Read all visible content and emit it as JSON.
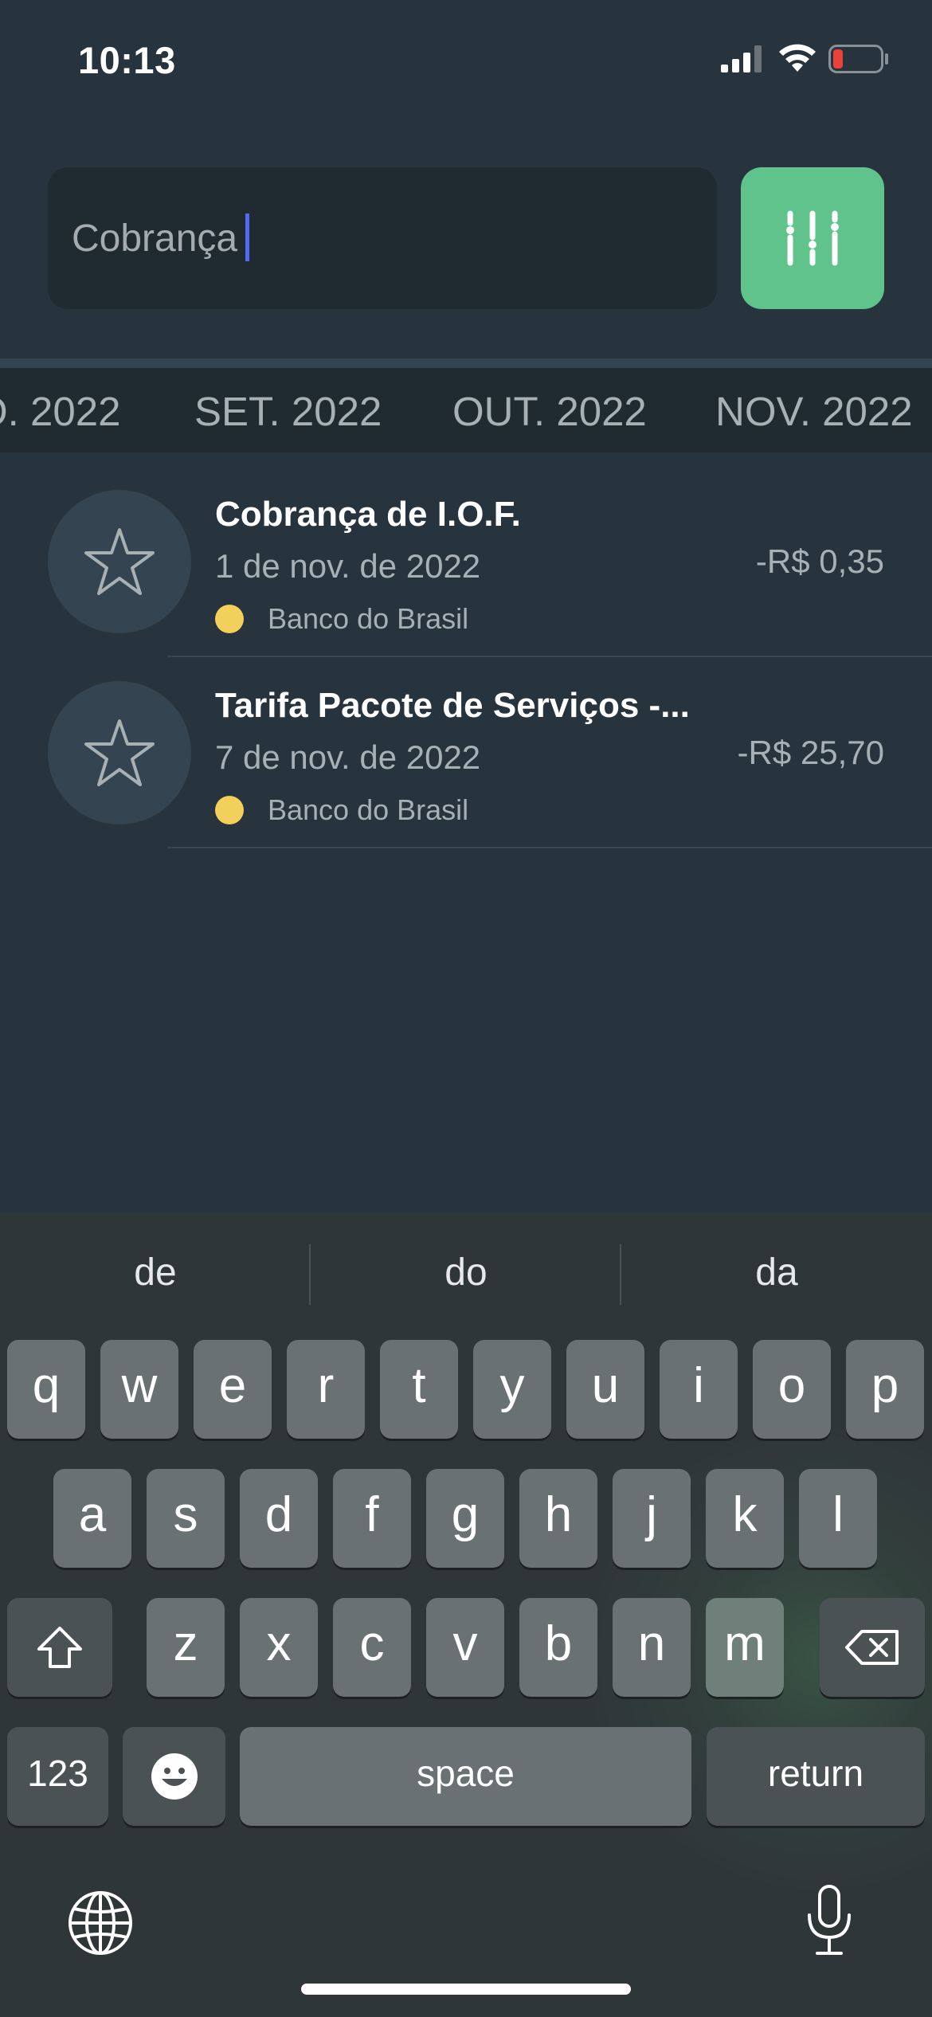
{
  "status_bar": {
    "time": "10:13"
  },
  "search": {
    "value": "Cobrança"
  },
  "months": [
    "O. 2022",
    "SET. 2022",
    "OUT. 2022",
    "NOV. 2022"
  ],
  "transactions": [
    {
      "title": "Cobrança de I.O.F.",
      "date": "1 de nov. de 2022",
      "bank": "Banco do Brasil",
      "amount": "-R$ 0,35"
    },
    {
      "title": "Tarifa Pacote de Serviços -...",
      "date": "7 de nov. de 2022",
      "bank": "Banco do Brasil",
      "amount": "-R$ 25,70"
    }
  ],
  "keyboard": {
    "suggestions": [
      "de",
      "do",
      "da"
    ],
    "row1": [
      "q",
      "w",
      "e",
      "r",
      "t",
      "y",
      "u",
      "i",
      "o",
      "p"
    ],
    "row2": [
      "a",
      "s",
      "d",
      "f",
      "g",
      "h",
      "j",
      "k",
      "l"
    ],
    "row3": [
      "z",
      "x",
      "c",
      "v",
      "b",
      "n",
      "m"
    ],
    "numbers_label": "123",
    "space_label": "space",
    "return_label": "return"
  },
  "colors": {
    "background": "#27343d",
    "filter_button": "#60c38b",
    "bank_dot": "#f3cf5b",
    "caret": "#5269f0"
  }
}
